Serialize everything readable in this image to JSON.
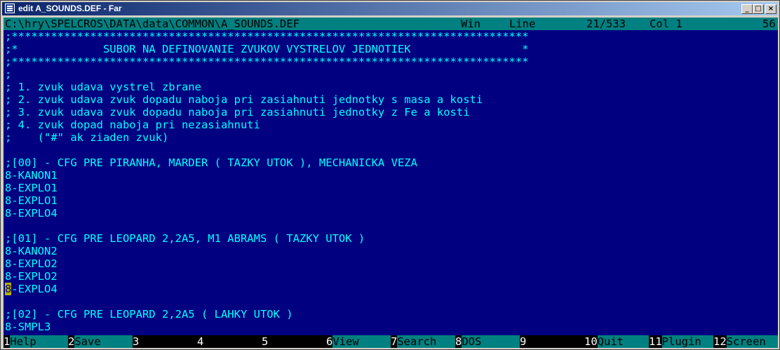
{
  "window": {
    "title": "edit A_SOUNDS.DEF - Far",
    "buttons": {
      "minimize": "_",
      "maximize": "□",
      "close": "×"
    }
  },
  "status": {
    "path": "C:\\hry\\SPELCROS\\DATA\\data\\COMMON\\A_SOUNDS.DEF",
    "encoding": "Win",
    "line_label": "Line",
    "line_pos": "21/533",
    "col": "Col 1",
    "char_code": "56"
  },
  "editor": {
    "lines": [
      ";*******************************************************************************",
      ";*             SUBOR NA DEFINOVANIE ZVUKOV VYSTRELOV JEDNOTIEK                 *",
      ";*******************************************************************************",
      ";",
      "; 1. zvuk udava vystrel zbrane",
      "; 2. zvuk udava zvuk dopadu naboja pri zasiahnuti jednotky s masa a kosti",
      "; 3. zvuk udava zvuk dopadu naboja pri zasiahnuti jednotky z Fe a kosti",
      "; 4. zvuk dopad naboja pri nezasiahnuti",
      ";    (\"#\" ak ziaden zvuk)",
      "",
      ";[00] - CFG PRE PIRANHA, MARDER ( TAZKY UTOK ), MECHANICKA VEZA",
      "8-KANON1",
      "8-EXPLO1",
      "8-EXPLO1",
      "8-EXPLO4",
      "",
      ";[01] - CFG PRE LEOPARD 2,2A5, M1 ABRAMS ( TAZKY UTOK )",
      "8-KANON2",
      "8-EXPLO2",
      "8-EXPLO2",
      "8-EXPLO4",
      "",
      ";[02] - CFG PRE LEOPARD 2,2A5 ( LAHKY UTOK )",
      "8-SMPL3"
    ],
    "cursor_line": 20
  },
  "keybar": [
    {
      "num": "1",
      "label": "Help"
    },
    {
      "num": "2",
      "label": "Save"
    },
    {
      "num": "3",
      "label": ""
    },
    {
      "num": "4",
      "label": ""
    },
    {
      "num": "5",
      "label": ""
    },
    {
      "num": "6",
      "label": "View"
    },
    {
      "num": "7",
      "label": "Search"
    },
    {
      "num": "8",
      "label": "DOS"
    },
    {
      "num": "9",
      "label": ""
    },
    {
      "num": "10",
      "label": "Quit"
    },
    {
      "num": "11",
      "label": "Plugin"
    },
    {
      "num": "12",
      "label": "Screen"
    }
  ],
  "colors": {
    "background": "#000080",
    "text": "#00ffff",
    "statusbar": "#008080",
    "keybar_label": "#008080",
    "cursor": "#b8b000"
  }
}
